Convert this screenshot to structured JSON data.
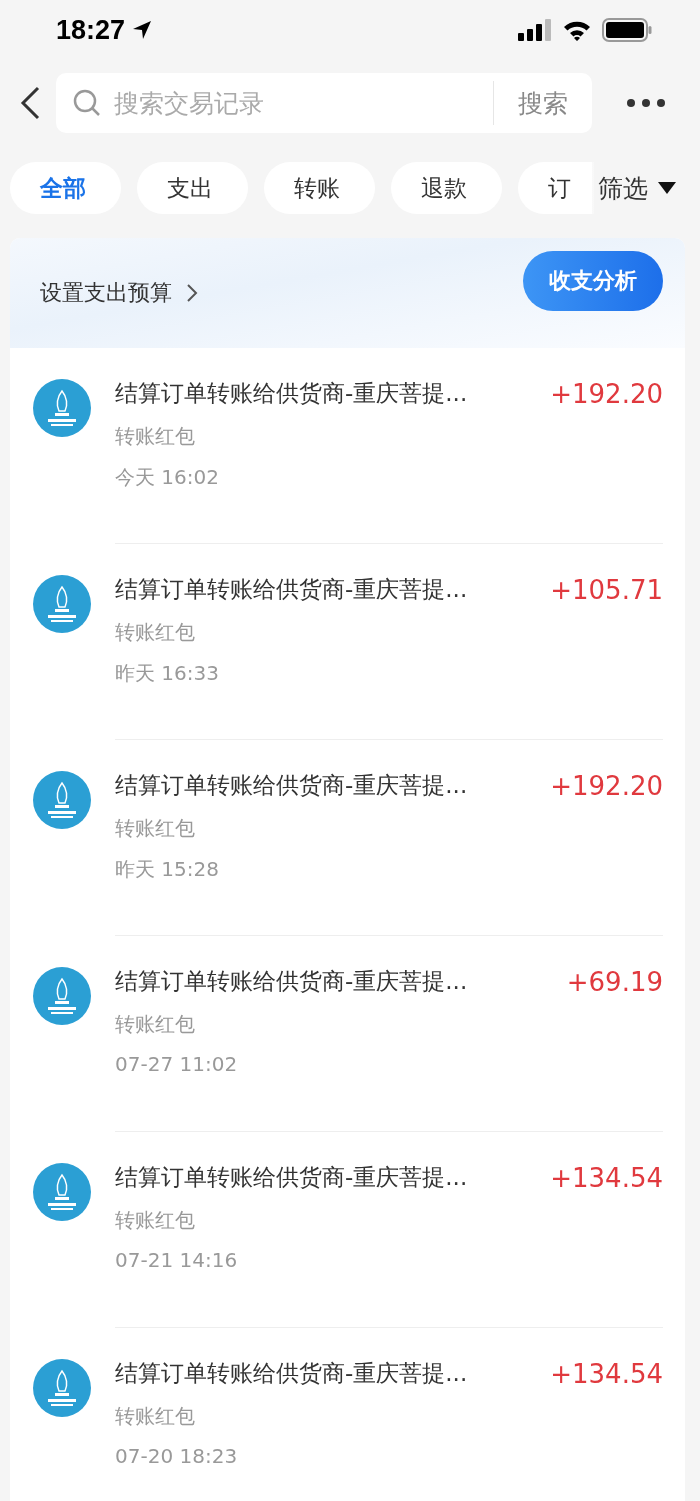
{
  "status_bar": {
    "time": "18:27"
  },
  "search": {
    "placeholder": "搜索交易记录",
    "button": "搜索"
  },
  "filters": [
    {
      "label": "全部",
      "selected": true
    },
    {
      "label": "支出",
      "selected": false
    },
    {
      "label": "转账",
      "selected": false
    },
    {
      "label": "退款",
      "selected": false
    },
    {
      "label": "订",
      "selected": false
    }
  ],
  "filter_menu": "筛选",
  "budget": {
    "link": "设置支出预算",
    "button": "收支分析"
  },
  "transactions": [
    {
      "title": "结算订单转账给供货商-重庆菩提...",
      "type": "转账红包",
      "time": "今天 16:02",
      "amount": "+192.20"
    },
    {
      "title": "结算订单转账给供货商-重庆菩提...",
      "type": "转账红包",
      "time": "昨天 16:33",
      "amount": "+105.71"
    },
    {
      "title": "结算订单转账给供货商-重庆菩提...",
      "type": "转账红包",
      "time": "昨天 15:28",
      "amount": "+192.20"
    },
    {
      "title": "结算订单转账给供货商-重庆菩提...",
      "type": "转账红包",
      "time": "07-27 11:02",
      "amount": "+69.19"
    },
    {
      "title": "结算订单转账给供货商-重庆菩提...",
      "type": "转账红包",
      "time": "07-21 14:16",
      "amount": "+134.54"
    },
    {
      "title": "结算订单转账给供货商-重庆菩提...",
      "type": "转账红包",
      "time": "07-20 18:23",
      "amount": "+134.54"
    }
  ]
}
